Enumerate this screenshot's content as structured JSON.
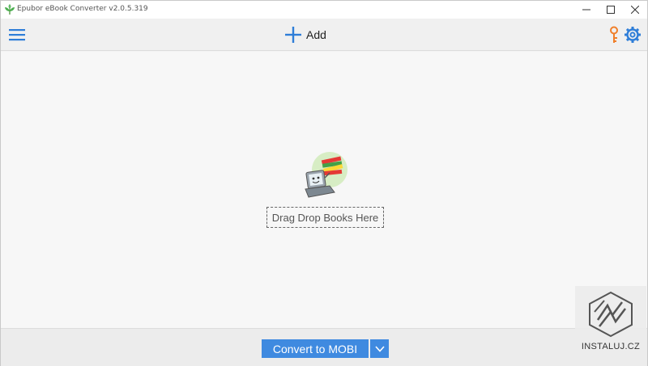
{
  "window": {
    "title": "Epubor eBook Converter v2.0.5.319",
    "controls": {
      "minimize": "minimize",
      "maximize": "maximize",
      "close": "close"
    }
  },
  "toolbar": {
    "add_label": "Add"
  },
  "main": {
    "drop_zone_text": "Drag Drop Books Here"
  },
  "bottom": {
    "convert_label": "Convert to MOBI"
  },
  "watermark": {
    "text": "INSTALUJ.CZ"
  },
  "icons": {
    "app": "leaf-icon",
    "menu": "hamburger-menu-icon",
    "add": "plus-icon",
    "key": "key-icon",
    "settings": "gear-icon",
    "dropdown": "chevron-down-icon"
  },
  "colors": {
    "accent_blue": "#3f8ae0",
    "key_orange": "#f07f2a",
    "leaf_green": "#4caf50"
  }
}
